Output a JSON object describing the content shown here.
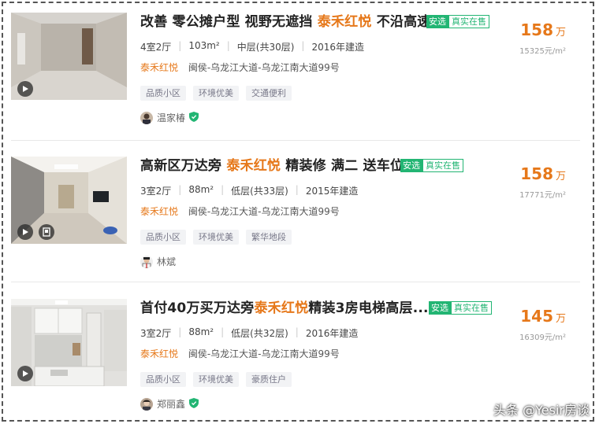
{
  "listings": [
    {
      "title_pre": "改善 零公摊户型 视野无遮挡 ",
      "title_hl": "泰禾红悦",
      "title_post": " 不沿高速",
      "tag_select": "安选",
      "tag_real": "真实在售",
      "layout": "4室2厅",
      "area": "103m²",
      "floor": "中层(共30层)",
      "built": "2016年建造",
      "community": "泰禾红悦",
      "address": "闽侯-乌龙江大道-乌龙江南大道99号",
      "features": [
        "品质小区",
        "环境优美",
        "交通便利"
      ],
      "agent": "温家椿",
      "price": "158",
      "price_unit": "万",
      "unit_price": "15325元/m²",
      "thumb_icons": [
        "play-icon"
      ]
    },
    {
      "title_pre": "高新区万达旁 ",
      "title_hl": "泰禾红悦",
      "title_post": " 精装修 满二 送车位",
      "tag_select": "安选",
      "tag_real": "真实在售",
      "layout": "3室2厅",
      "area": "88m²",
      "floor": "低层(共33层)",
      "built": "2015年建造",
      "community": "泰禾红悦",
      "address": "闽侯-乌龙江大道-乌龙江南大道99号",
      "features": [
        "品质小区",
        "环境优美",
        "繁华地段"
      ],
      "agent": "林斌",
      "price": "158",
      "price_unit": "万",
      "unit_price": "17771元/m²",
      "thumb_icons": [
        "play-icon",
        "gallery-icon"
      ]
    },
    {
      "title_pre": "首付40万买万达旁",
      "title_hl": "泰禾红悦",
      "title_post": "精装3房电梯高层...",
      "tag_select": "安选",
      "tag_real": "真实在售",
      "layout": "3室2厅",
      "area": "88m²",
      "floor": "低层(共32层)",
      "built": "2016年建造",
      "community": "泰禾红悦",
      "address": "闽侯-乌龙江大道-乌龙江南大道99号",
      "features": [
        "品质小区",
        "环境优美",
        "豪质住户"
      ],
      "agent": "郑丽鑫",
      "price": "145",
      "price_unit": "万",
      "unit_price": "16309元/m²",
      "thumb_icons": [
        "play-icon"
      ]
    }
  ],
  "watermark": "头条 @Yesir房谈",
  "colors": {
    "accent": "#e6781a",
    "tag_green": "#22b573",
    "feature_bg": "#f2f3f5"
  }
}
